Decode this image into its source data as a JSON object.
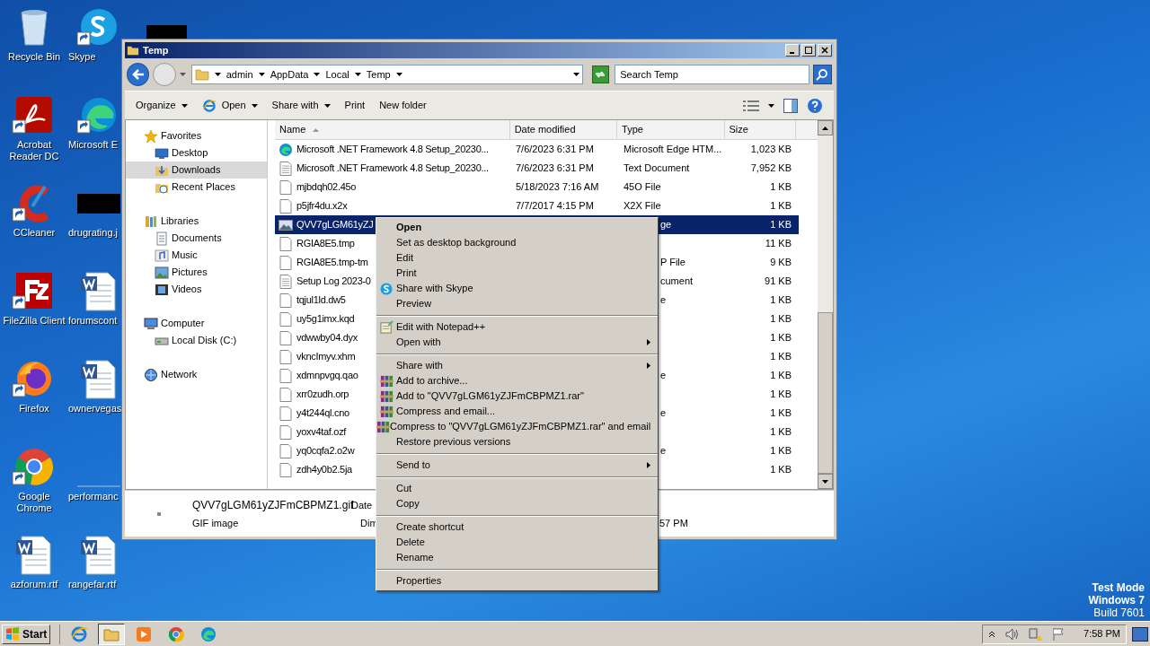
{
  "desktop": {
    "columns": [
      [
        {
          "label": "Recycle Bin",
          "kind": "recycle",
          "shortcut": false
        },
        {
          "label": "Acrobat Reader DC",
          "kind": "acrobat",
          "shortcut": true
        },
        {
          "label": "CCleaner",
          "kind": "ccleaner",
          "shortcut": true
        },
        {
          "label": "FileZilla Client",
          "kind": "filezilla",
          "shortcut": true
        },
        {
          "label": "Firefox",
          "kind": "firefox",
          "shortcut": true
        },
        {
          "label": "Google Chrome",
          "kind": "chrome",
          "shortcut": true
        },
        {
          "label": "azforum.rtf",
          "kind": "word",
          "shortcut": false
        }
      ],
      [
        {
          "label": "Skype",
          "kind": "skype",
          "shortcut": true
        },
        {
          "label": "Microsoft E",
          "kind": "edge",
          "shortcut": true
        },
        {
          "label": "drugrating.j",
          "kind": "redacted",
          "shortcut": false
        },
        {
          "label": "forumscont",
          "kind": "word",
          "shortcut": false
        },
        {
          "label": "ownervegas",
          "kind": "word",
          "shortcut": false
        },
        {
          "label": "performanc",
          "kind": "blank",
          "shortcut": false
        },
        {
          "label": "rangefar.rtf",
          "kind": "word",
          "shortcut": false
        }
      ]
    ],
    "system_notice": [
      {
        "text": "Test Mode",
        "bold": true
      },
      {
        "text": "Windows 7",
        "bold": true
      },
      {
        "text": "Build 7601",
        "bold": false
      }
    ]
  },
  "window": {
    "title": "Temp",
    "breadcrumb": [
      "admin",
      "AppData",
      "Local",
      "Temp"
    ],
    "search": {
      "placeholder": "Search Temp"
    },
    "toolbar": [
      {
        "label": "Organize",
        "dropdown": true
      },
      {
        "label": "Open",
        "dropdown": true
      },
      {
        "label": "Share with",
        "dropdown": true
      },
      {
        "label": "Print",
        "dropdown": false
      },
      {
        "label": "New folder",
        "dropdown": false
      }
    ],
    "nav": [
      {
        "label": "Favorites",
        "kind": "star",
        "selected": false,
        "children": [
          {
            "label": "Desktop",
            "kind": "desktop",
            "selected": false
          },
          {
            "label": "Downloads",
            "kind": "downloads",
            "selected": true
          },
          {
            "label": "Recent Places",
            "kind": "recent",
            "selected": false
          }
        ]
      },
      {
        "label": "Libraries",
        "kind": "libraries",
        "selected": false,
        "children": [
          {
            "label": "Documents",
            "kind": "documents",
            "selected": false
          },
          {
            "label": "Music",
            "kind": "music",
            "selected": false
          },
          {
            "label": "Pictures",
            "kind": "pictures",
            "selected": false
          },
          {
            "label": "Videos",
            "kind": "videos",
            "selected": false
          }
        ]
      },
      {
        "label": "Computer",
        "kind": "computer",
        "selected": false,
        "children": [
          {
            "label": "Local Disk (C:)",
            "kind": "disk",
            "selected": false
          }
        ]
      },
      {
        "label": "Network",
        "kind": "network",
        "selected": false
      }
    ],
    "columns": [
      {
        "label": "Name",
        "sorted": true
      },
      {
        "label": "Date modified",
        "sorted": false
      },
      {
        "label": "Type",
        "sorted": false
      },
      {
        "label": "Size",
        "sorted": false
      }
    ],
    "rows": [
      {
        "name": "Microsoft .NET Framework 4.8 Setup_20230...",
        "date": "7/6/2023 6:31 PM",
        "type": "Microsoft Edge HTM...",
        "size": "1,023 KB",
        "kind": "edge",
        "selected": false
      },
      {
        "name": "Microsoft .NET Framework 4.8 Setup_20230...",
        "date": "7/6/2023 6:31 PM",
        "type": "Text Document",
        "size": "7,952 KB",
        "kind": "text",
        "selected": false
      },
      {
        "name": "mjbdqh02.45o",
        "date": "5/18/2023 7:16 AM",
        "type": "45O File",
        "size": "1 KB",
        "kind": "file",
        "selected": false
      },
      {
        "name": "p5jfr4du.x2x",
        "date": "7/7/2017 4:15 PM",
        "type": "X2X File",
        "size": "1 KB",
        "kind": "file",
        "selected": false
      },
      {
        "name": "QVV7gLGM61yZJ",
        "type": "ge",
        "size": "1 KB",
        "kind": "image",
        "selected": true
      },
      {
        "name": "RGIA8E5.tmp",
        "size": "11 KB",
        "kind": "file",
        "selected": false
      },
      {
        "name": "RGIA8E5.tmp-tm",
        "type": "P File",
        "size": "9 KB",
        "kind": "file",
        "selected": false
      },
      {
        "name": "Setup Log 2023-0",
        "type": "cument",
        "size": "91 KB",
        "kind": "text",
        "selected": false
      },
      {
        "name": "tqjul1ld.dw5",
        "type": "e",
        "size": "1 KB",
        "kind": "file",
        "selected": false
      },
      {
        "name": "uy5g1imx.kqd",
        "size": "1 KB",
        "kind": "file",
        "selected": false
      },
      {
        "name": "vdwwby04.dyx",
        "size": "1 KB",
        "kind": "file",
        "selected": false
      },
      {
        "name": "vkncImyv.xhm",
        "size": "1 KB",
        "kind": "file",
        "selected": false
      },
      {
        "name": "xdmnpvgq.qao",
        "type": "e",
        "size": "1 KB",
        "kind": "file",
        "selected": false
      },
      {
        "name": "xrr0zudh.orp",
        "size": "1 KB",
        "kind": "file",
        "selected": false
      },
      {
        "name": "y4t244ql.cno",
        "type": "e",
        "size": "1 KB",
        "kind": "file",
        "selected": false
      },
      {
        "name": "yoxv4taf.ozf",
        "size": "1 KB",
        "kind": "file",
        "selected": false
      },
      {
        "name": "yq0cqfa2.o2w",
        "type": "e",
        "size": "1 KB",
        "kind": "file",
        "selected": false
      },
      {
        "name": "zdh4y0b2.5ja",
        "size": "1 KB",
        "kind": "file",
        "selected": false
      }
    ],
    "details": {
      "name": "QVV7gLGM61yZJFmCBPMZ1.gif",
      "type": "GIF image",
      "field_1": "Date",
      "field_2": "Dim",
      "value_2": "57 PM"
    }
  },
  "context_menu": [
    [
      {
        "label": "Open",
        "default": true,
        "submenu": false,
        "kind": "plain"
      },
      {
        "label": "Set as desktop background",
        "default": false,
        "submenu": false,
        "kind": "plain"
      },
      {
        "label": "Edit",
        "default": false,
        "submenu": false,
        "kind": "plain"
      },
      {
        "label": "Print",
        "default": false,
        "submenu": false,
        "kind": "plain"
      },
      {
        "label": "Share with Skype",
        "default": false,
        "submenu": false,
        "kind": "skype"
      },
      {
        "label": "Preview",
        "default": false,
        "submenu": false,
        "kind": "plain"
      }
    ],
    [
      {
        "label": "Edit with Notepad++",
        "default": false,
        "submenu": false,
        "kind": "notepad"
      },
      {
        "label": "Open with",
        "default": false,
        "submenu": true,
        "kind": "plain"
      }
    ],
    [
      {
        "label": "Share with",
        "default": false,
        "submenu": true,
        "kind": "plain"
      },
      {
        "label": "Add to archive...",
        "default": false,
        "submenu": false,
        "kind": "winrar"
      },
      {
        "label": "Add to \"QVV7gLGM61yZJFmCBPMZ1.rar\"",
        "default": false,
        "submenu": false,
        "kind": "winrar"
      },
      {
        "label": "Compress and email...",
        "default": false,
        "submenu": false,
        "kind": "winrar"
      },
      {
        "label": "Compress to \"QVV7gLGM61yZJFmCBPMZ1.rar\" and email",
        "default": false,
        "submenu": false,
        "kind": "winrar"
      },
      {
        "label": "Restore previous versions",
        "default": false,
        "submenu": false,
        "kind": "plain"
      }
    ],
    [
      {
        "label": "Send to",
        "default": false,
        "submenu": true,
        "kind": "plain"
      }
    ],
    [
      {
        "label": "Cut",
        "default": false,
        "submenu": false,
        "kind": "plain"
      },
      {
        "label": "Copy",
        "default": false,
        "submenu": false,
        "kind": "plain"
      }
    ],
    [
      {
        "label": "Create shortcut",
        "default": false,
        "submenu": false,
        "kind": "plain"
      },
      {
        "label": "Delete",
        "default": false,
        "submenu": false,
        "kind": "plain"
      },
      {
        "label": "Rename",
        "default": false,
        "submenu": false,
        "kind": "plain"
      }
    ],
    [
      {
        "label": "Properties",
        "default": false,
        "submenu": false,
        "kind": "plain"
      }
    ]
  ],
  "taskbar": {
    "start": "Start",
    "apps": [
      {
        "kind": "ie",
        "selected": false
      },
      {
        "kind": "explorer",
        "selected": true
      },
      {
        "kind": "media",
        "selected": false
      },
      {
        "kind": "chrome",
        "selected": false
      },
      {
        "kind": "edge",
        "selected": false
      }
    ],
    "clock": "7:58 PM"
  }
}
